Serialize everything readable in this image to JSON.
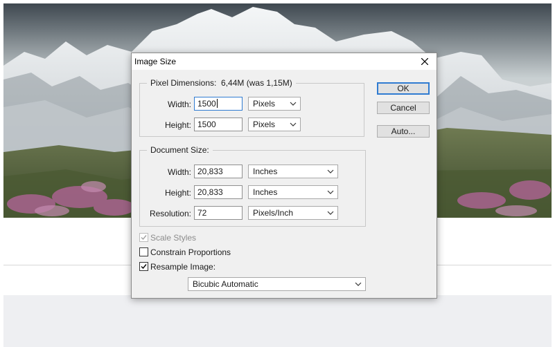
{
  "dialog": {
    "title": "Image Size",
    "buttons": {
      "ok": "OK",
      "cancel": "Cancel",
      "auto": "Auto..."
    },
    "pixel_dimensions": {
      "label": "Pixel Dimensions:",
      "value": "6,44M (was 1,15M)",
      "width_label": "Width:",
      "width_value": "1500",
      "width_unit": "Pixels",
      "height_label": "Height:",
      "height_value": "1500",
      "height_unit": "Pixels"
    },
    "document_size": {
      "label": "Document Size:",
      "width_label": "Width:",
      "width_value": "20,833",
      "width_unit": "Inches",
      "height_label": "Height:",
      "height_value": "20,833",
      "height_unit": "Inches",
      "resolution_label": "Resolution:",
      "resolution_value": "72",
      "resolution_unit": "Pixels/Inch"
    },
    "options": {
      "scale_styles": {
        "label": "Scale Styles",
        "checked": true,
        "disabled": true
      },
      "constrain_proportions": {
        "label": "Constrain Proportions",
        "checked": false
      },
      "resample_image": {
        "label": "Resample Image:",
        "checked": true
      }
    },
    "resample_method": "Bicubic Automatic"
  },
  "colors": {
    "accent": "#2f7bd1",
    "dialog_bg": "#f0f0f0",
    "sky": "#c9d0d2"
  },
  "icons": [
    "close-icon",
    "chevron-down-icon",
    "checkmark-icon"
  ]
}
